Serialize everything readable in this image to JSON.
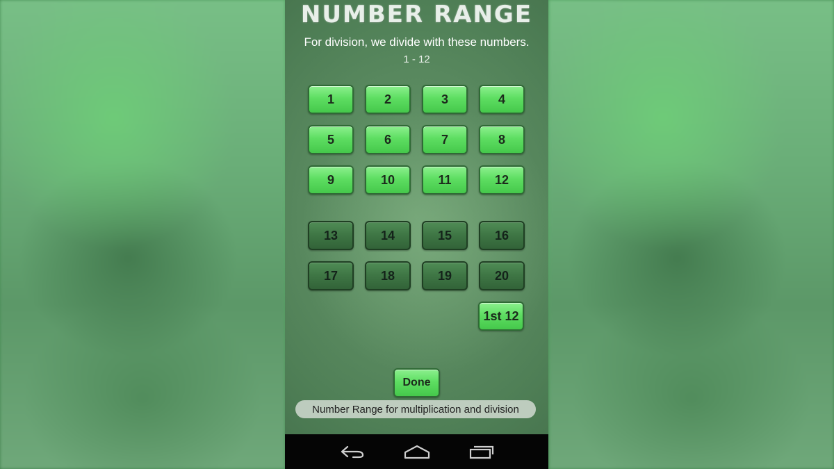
{
  "screen": {
    "title": "NUMBER RANGE",
    "subtitle": "For division, we divide with these numbers.",
    "range_text": "1 - 12"
  },
  "active_numbers": [
    "1",
    "2",
    "3",
    "4",
    "5",
    "6",
    "7",
    "8",
    "9",
    "10",
    "11",
    "12"
  ],
  "inactive_numbers": [
    "13",
    "14",
    "15",
    "16",
    "17",
    "18",
    "19",
    "20"
  ],
  "preset_button": "1st 12",
  "done_button": "Done",
  "caption": "Number Range for multiplication and division",
  "navbar": {
    "icons": [
      "back-icon",
      "home-icon",
      "recent-apps-icon"
    ]
  },
  "colors": {
    "active_button": "#5ede62",
    "inactive_button": "#3e7544",
    "board": "#4f7f56"
  }
}
